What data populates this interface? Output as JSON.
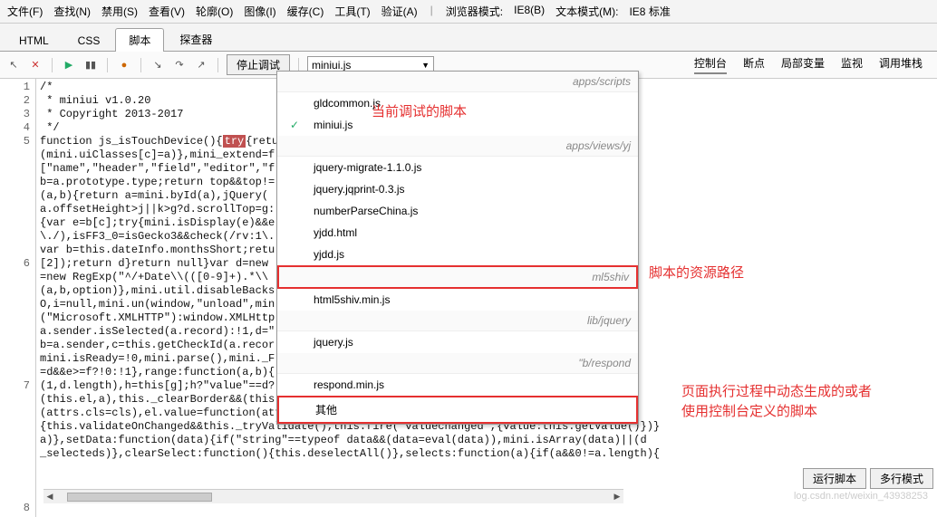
{
  "menubar": {
    "items": [
      "文件(F)",
      "查找(N)",
      "禁用(S)",
      "查看(V)",
      "轮廓(O)",
      "图像(I)",
      "缓存(C)",
      "工具(T)",
      "验证(A)"
    ],
    "browser_mode_label": "浏览器模式:",
    "browser_mode_value": "IE8(B)",
    "text_mode_label": "文本模式(M):",
    "text_mode_value": "IE8 标准"
  },
  "tabs": {
    "items": [
      "HTML",
      "CSS",
      "脚本",
      "探查器"
    ],
    "active": 2
  },
  "toolbar": {
    "stop_label": "停止调试",
    "dropdown_selected": "miniui.js"
  },
  "right_tabs": {
    "items": [
      "控制台",
      "断点",
      "局部变量",
      "监视",
      "调用堆栈"
    ],
    "active": 0
  },
  "gutter_lines": [
    "1",
    "2",
    "3",
    "4",
    "5",
    "6",
    "7",
    "8"
  ],
  "code": {
    "l1": "/*",
    "l2": " * miniui v1.0.20",
    "l3": " * Copyright 2013-2017",
    "l4": " */",
    "l5a": "function js_isTouchDevice(){",
    "l5hl": "try",
    "l5b": "{retu",
    "l5c": "(mini.uiClasses[c]=a)},mini_extend=f",
    "l5d": "[\"name\",\"header\",\"field\",\"editor\",\"f",
    "l5e": "b=a.prototype.type;return top&&top!=",
    "l5f": "(a,b){return a=mini.byId(a),jQuery(",
    "l5g": "a.offsetHeight>j||k>g?d.scrollTop=g:",
    "l5h": "{var e=b[c];try{mini.isDisplay(e)&&e",
    "l5i": "\\./),isFF3_0=isGecko3&&check(/rv:1\\.",
    "l6a": "var b=this.dateInfo.monthsShort;retu",
    "l6b": "[2]);return d}return null}var d=new",
    "l6c": "=new RegExp(\"^/+Date\\\\(([0-9]+).*\\\\",
    "l6d": "(a,b,option)},mini.util.disableBacks",
    "l6e": "O,i=null,mini.un(window,\"unload\",min",
    "l6f": "(\"Microsoft.XMLHTTP\"):window.XMLHttp",
    "l6g": "a.sender.isSelected(a.record):!1,d=\"",
    "l6h": "b=a.sender,c=this.getCheckId(a.recor",
    "l7a": "mini.isReady=!0,mini.parse(),mini._F",
    "l7b": "=d&&e>=f?!0:!1},range:function(a,b){",
    "l7c": "(1,d.length),h=this[g];h?\"value\"==d?",
    "l7d": "(this.el,a),this._clearBorder&&(this",
    "l7e": "(attrs.cls=cls),el.value=function(attrs.val",
    "l7f": "{this.validateOnChanged&&this._tryValidate(),this.fire(\"valuechanged\",{value:this.getValue()})}",
    "l7g": "a)},setData:function(data){if(\"string\"==typeof data&&(data=eval(data)),mini.isArray(data)||(d",
    "l7h": "_selecteds)},clearSelect:function(){this.deselectAll()},selects:function(a){if(a&&0!=a.length){"
  },
  "panel": {
    "grp1": "apps/scripts",
    "items1": [
      "gldcommon.js",
      "miniui.js"
    ],
    "grp2": "apps/views/yj",
    "items2": [
      "jquery-migrate-1.1.0.js",
      "jquery.jqprint-0.3.js",
      "numberParseChina.js",
      "yjdd.html",
      "yjdd.js"
    ],
    "grp3": "ml5shiv",
    "items3": [
      "html5shiv.min.js"
    ],
    "grp4": "lib/jquery",
    "items4": [
      "jquery.js"
    ],
    "grp5": "\"b/respond",
    "items5": [
      "respond.min.js"
    ],
    "other": "其他"
  },
  "annotations": {
    "a1": "当前调试的脚本",
    "a2": "脚本的资源路径",
    "a3": "页面执行过程中动态生成的或者使用控制台定义的脚本"
  },
  "rightpane": {
    "run": "运行脚本",
    "multi": "多行模式"
  },
  "watermark": "log.csdn.net/weixin_43938253"
}
